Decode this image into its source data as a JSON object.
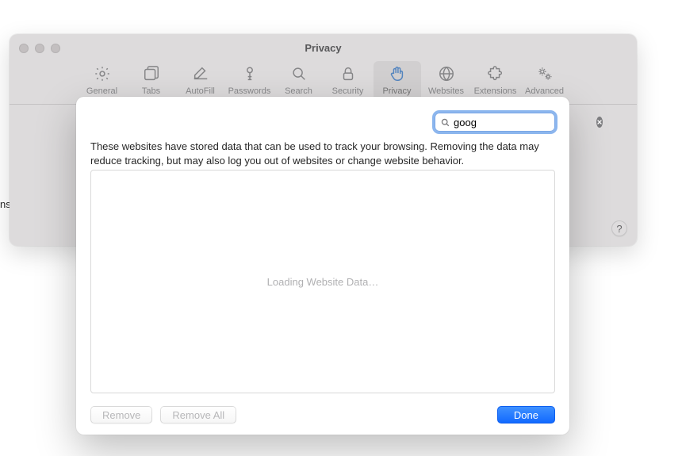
{
  "window": {
    "title": "Privacy"
  },
  "toolbar": {
    "items": [
      {
        "id": "general",
        "label": "General"
      },
      {
        "id": "tabs",
        "label": "Tabs"
      },
      {
        "id": "autofill",
        "label": "AutoFill"
      },
      {
        "id": "passwords",
        "label": "Passwords"
      },
      {
        "id": "search",
        "label": "Search"
      },
      {
        "id": "security",
        "label": "Security"
      },
      {
        "id": "privacy",
        "label": "Privacy"
      },
      {
        "id": "websites",
        "label": "Websites"
      },
      {
        "id": "extensions",
        "label": "Extensions"
      },
      {
        "id": "advanced",
        "label": "Advanced"
      }
    ],
    "active": "privacy"
  },
  "help_glyph": "?",
  "left_stray": "ns",
  "sheet": {
    "search": {
      "value": "goog"
    },
    "description": "These websites have stored data that can be used to track your browsing. Removing the data may reduce tracking, but may also log you out of websites or change website behavior.",
    "loading_text": "Loading Website Data…",
    "buttons": {
      "remove": "Remove",
      "remove_all": "Remove All",
      "done": "Done"
    }
  }
}
